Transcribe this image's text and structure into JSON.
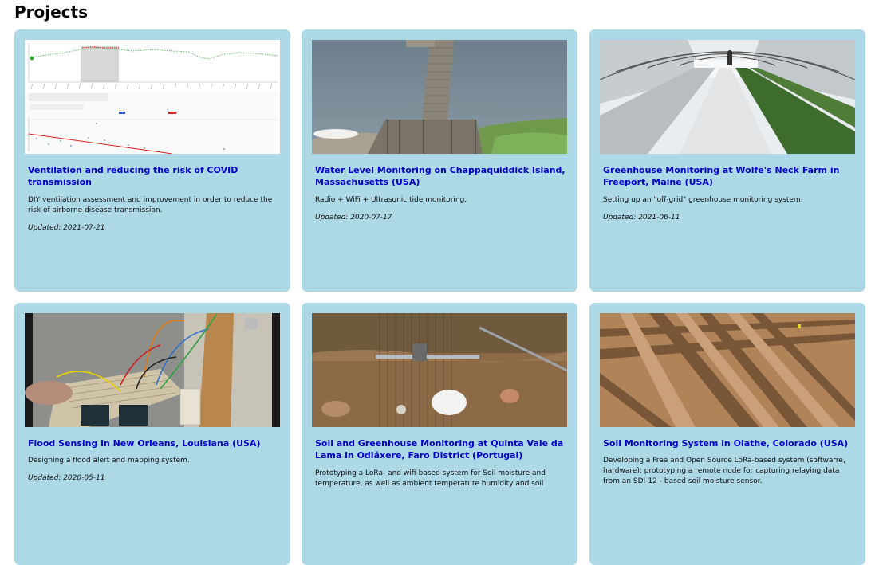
{
  "page": {
    "title": "Projects"
  },
  "projects": [
    {
      "title": "Ventilation and reducing the risk of COVID transmission",
      "description": "DIY ventilation assessment and improvement in order to reduce the risk of airborne disease transmission.",
      "updated": "Updated: 2021-07-21",
      "image": "ventilation-chart-image"
    },
    {
      "title": "Water Level Monitoring on Chappaquiddick Island, Massachusetts (USA)",
      "description": "Radio + WiFi + Ultrasonic tide monitoring.",
      "updated": "Updated: 2020-07-17",
      "image": "dock-water-image"
    },
    {
      "title": "Greenhouse Monitoring at Wolfe's Neck Farm in Freeport, Maine (USA)",
      "description": "Setting up an \"off-grid\" greenhouse monitoring system.",
      "updated": "Updated: 2021-06-11",
      "image": "greenhouse-image"
    },
    {
      "title": "Flood Sensing in New Orleans, Louisiana (USA)",
      "description": "Designing a flood alert and mapping system.",
      "updated": "Updated: 2020-05-11",
      "image": "breadboard-circuit-image"
    },
    {
      "title": "Soil and Greenhouse Monitoring at Quinta Vale da Lama in Odiáxere, Faro District (Portugal)",
      "description": "Prototyping a LoRa- and wifi-based system for Soil moisture and temperature, as well as ambient temperature humidity and soil",
      "updated": "",
      "image": "field-sensor-image"
    },
    {
      "title": "Soil Monitoring System in Olathe, Colorado (USA)",
      "description": "Developing a Free and Open Source LoRa-based system (softwarre, hardware); prototyping a remote node for capturing relaying data from an SDI-12 - based soil moisture sensor.",
      "updated": "",
      "image": "plowed-field-image"
    }
  ],
  "colors": {
    "card_bg": "#add8e6",
    "link": "#0000cc"
  }
}
